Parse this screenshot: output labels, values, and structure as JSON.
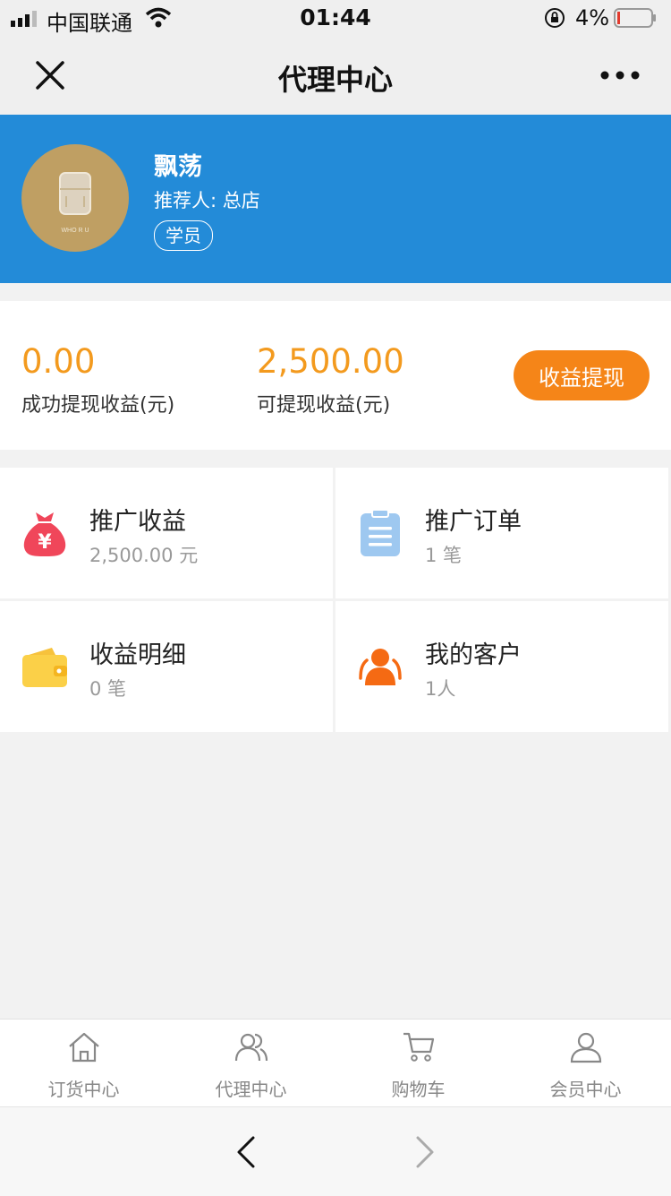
{
  "status_bar": {
    "carrier": "中国联通",
    "time": "01:44",
    "battery_percent": "4%"
  },
  "nav": {
    "title": "代理中心"
  },
  "profile": {
    "name": "飘荡",
    "referrer": "推荐人: 总店",
    "badge": "学员"
  },
  "earnings": {
    "withdrawn_value": "0.00",
    "withdrawn_label": "成功提现收益(元)",
    "available_value": "2,500.00",
    "available_label": "可提现收益(元)",
    "withdraw_button": "收益提现",
    "accent_color": "#f39a1e"
  },
  "grid": [
    {
      "title": "推广收益",
      "sub": "2,500.00 元",
      "icon": "money-bag-icon"
    },
    {
      "title": "推广订单",
      "sub": "1 笔",
      "icon": "clipboard-icon"
    },
    {
      "title": "收益明细",
      "sub": "0 笔",
      "icon": "wallet-icon"
    },
    {
      "title": "我的客户",
      "sub": "1人",
      "icon": "customers-icon"
    }
  ],
  "tabbar": [
    {
      "label": "订货中心",
      "icon": "home-icon"
    },
    {
      "label": "代理中心",
      "icon": "agents-icon"
    },
    {
      "label": "购物车",
      "icon": "cart-icon"
    },
    {
      "label": "会员中心",
      "icon": "user-icon"
    }
  ],
  "colors": {
    "banner": "#238bd8",
    "button": "#f58518"
  }
}
